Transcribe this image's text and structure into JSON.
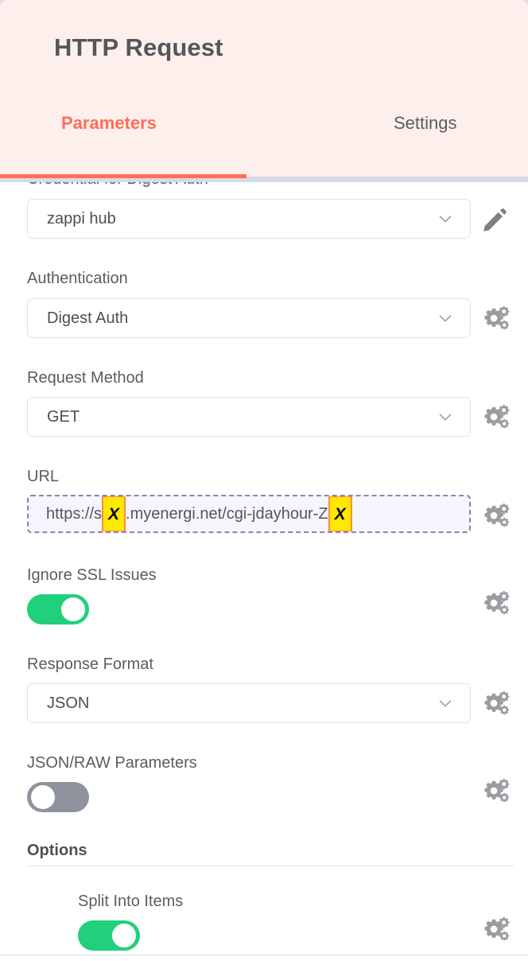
{
  "header": {
    "title": "HTTP Request",
    "tabs": [
      {
        "label": "Parameters",
        "active": true
      },
      {
        "label": "Settings",
        "active": false
      }
    ],
    "accent_color": "#ff6d5a",
    "background_color": "#fdf0ec"
  },
  "fields": {
    "credential": {
      "label": "Credential for Digest Auth",
      "value": "zappi hub",
      "edit_icon": "pencil-icon"
    },
    "authentication": {
      "label": "Authentication",
      "value": "Digest Auth",
      "options_icon": "gear-icon"
    },
    "request_method": {
      "label": "Request Method",
      "value": "GET",
      "options_icon": "gear-icon"
    },
    "url": {
      "label": "URL",
      "value_prefix": "https://s",
      "redaction_1": "X",
      "value_middle": ".myenergi.net/cgi-jdayhour-Z",
      "redaction_2": "X",
      "value_suffix": "",
      "highlight_background": "#ffe800",
      "highlight_border": "#ff8a3d",
      "options_icon": "gear-icon"
    },
    "ignore_ssl_issues": {
      "label": "Ignore SSL Issues",
      "state": "on",
      "on_color": "#21d07a",
      "options_icon": "gear-icon"
    },
    "response_format": {
      "label": "Response Format",
      "value": "JSON",
      "options_icon": "gear-icon"
    },
    "json_raw_parameters": {
      "label": "JSON/RAW Parameters",
      "state": "off",
      "off_color": "#8e939d",
      "options_icon": "gear-icon"
    }
  },
  "options_section": {
    "title": "Options",
    "items": [
      {
        "label": "Split Into Items",
        "state": "on",
        "options_icon": "gear-icon"
      }
    ]
  }
}
